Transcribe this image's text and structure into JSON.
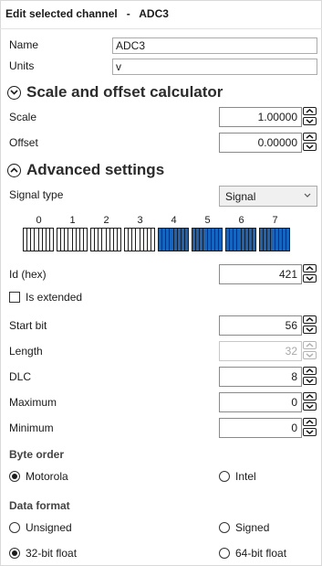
{
  "header": {
    "title": "Edit selected channel   -   ADC3"
  },
  "name": {
    "label": "Name",
    "value": "ADC3"
  },
  "units": {
    "label": "Units",
    "value": "v"
  },
  "scale_section": {
    "title": "Scale and offset calculator"
  },
  "scale": {
    "label": "Scale",
    "value": "1.00000"
  },
  "offset": {
    "label": "Offset",
    "value": "0.00000"
  },
  "advanced_section": {
    "title": "Advanced settings"
  },
  "signal_type": {
    "label": "Signal type",
    "selected": "Signal"
  },
  "bytes": {
    "labels": [
      "0",
      "1",
      "2",
      "3",
      "4",
      "5",
      "6",
      "7"
    ],
    "highlighted_bytes": [
      4,
      5,
      6,
      7
    ],
    "highlight_color": "#1565c0"
  },
  "id_hex": {
    "label": "Id (hex)",
    "value": "421"
  },
  "is_extended": {
    "label": "Is extended",
    "checked": false
  },
  "start_bit": {
    "label": "Start bit",
    "value": "56"
  },
  "length": {
    "label": "Length",
    "value": "32",
    "disabled": true
  },
  "dlc": {
    "label": "DLC",
    "value": "8"
  },
  "maximum": {
    "label": "Maximum",
    "value": "0"
  },
  "minimum": {
    "label": "Minimum",
    "value": "0"
  },
  "byte_order": {
    "label": "Byte order",
    "options": [
      {
        "label": "Motorola",
        "selected": true
      },
      {
        "label": "Intel",
        "selected": false
      }
    ]
  },
  "data_format": {
    "label": "Data format",
    "options": [
      {
        "label": "Unsigned",
        "selected": false
      },
      {
        "label": "Signed",
        "selected": false
      },
      {
        "label": "32-bit float",
        "selected": true
      },
      {
        "label": "64-bit float",
        "selected": false
      }
    ]
  }
}
